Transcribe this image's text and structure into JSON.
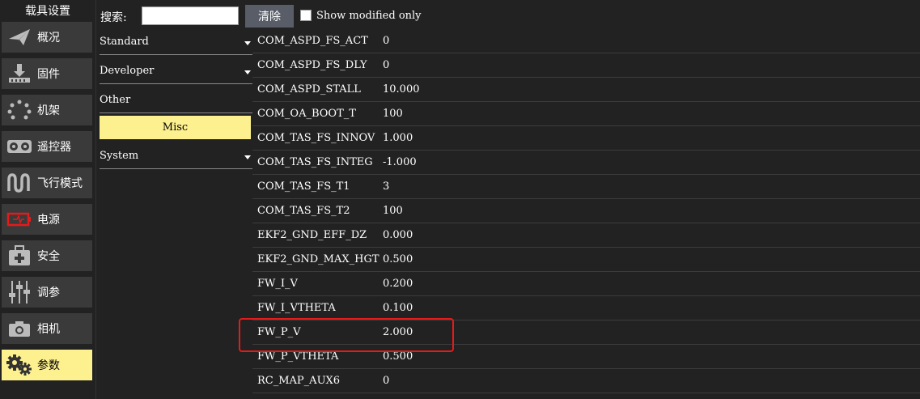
{
  "sidebar": {
    "title": "载具设置",
    "items": [
      {
        "label": "概况",
        "icon": "paper-plane-icon",
        "active": false
      },
      {
        "label": "固件",
        "icon": "firmware-download-icon",
        "active": false
      },
      {
        "label": "机架",
        "icon": "airframe-dots-icon",
        "active": false
      },
      {
        "label": "遥控器",
        "icon": "radio-controller-icon",
        "active": false
      },
      {
        "label": "飞行模式",
        "icon": "flight-modes-wave-icon",
        "active": false
      },
      {
        "label": "电源",
        "icon": "battery-icon",
        "active": false
      },
      {
        "label": "安全",
        "icon": "safety-medkit-icon",
        "active": false
      },
      {
        "label": "调参",
        "icon": "tuning-sliders-icon",
        "active": false
      },
      {
        "label": "相机",
        "icon": "camera-icon",
        "active": false
      },
      {
        "label": "参数",
        "icon": "gears-icon",
        "active": true
      }
    ]
  },
  "search": {
    "label": "搜索:",
    "value": "",
    "clear_label": "清除",
    "show_modified_label": "Show modified only",
    "show_modified_checked": false
  },
  "groups": [
    {
      "label": "Standard",
      "collapsible": true
    },
    {
      "label": "Developer",
      "collapsible": true
    },
    {
      "label": "Other",
      "collapsible": false
    },
    {
      "label": "System",
      "collapsible": true
    }
  ],
  "selected_group": "Misc",
  "params": [
    {
      "name": "COM_ASPD_FS_ACT",
      "value": "0"
    },
    {
      "name": "COM_ASPD_FS_DLY",
      "value": "0"
    },
    {
      "name": "COM_ASPD_STALL",
      "value": "10.000"
    },
    {
      "name": "COM_OA_BOOT_T",
      "value": "100"
    },
    {
      "name": "COM_TAS_FS_INNOV",
      "value": "1.000"
    },
    {
      "name": "COM_TAS_FS_INTEG",
      "value": "-1.000"
    },
    {
      "name": "COM_TAS_FS_T1",
      "value": "3"
    },
    {
      "name": "COM_TAS_FS_T2",
      "value": "100"
    },
    {
      "name": "EKF2_GND_EFF_DZ",
      "value": "0.000"
    },
    {
      "name": "EKF2_GND_MAX_HGT",
      "value": "0.500"
    },
    {
      "name": "FW_I_V",
      "value": "0.200"
    },
    {
      "name": "FW_I_VTHETA",
      "value": "0.100"
    },
    {
      "name": "FW_P_V",
      "value": "2.000"
    },
    {
      "name": "FW_P_VTHETA",
      "value": "0.500"
    },
    {
      "name": "RC_MAP_AUX6",
      "value": "0"
    }
  ],
  "highlighted_param": "FW_P_V",
  "colors": {
    "background": "#222222",
    "active": "#fdf08f",
    "sidebar_item": "#3a3a3a",
    "highlight": "#e51a1a"
  }
}
